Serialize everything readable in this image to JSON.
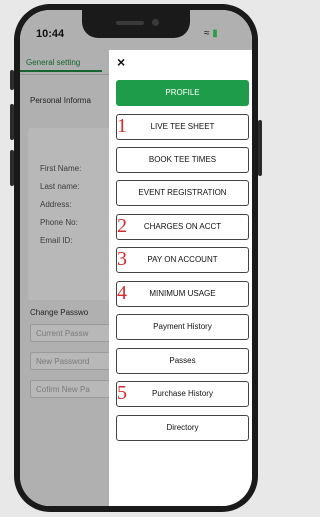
{
  "status": {
    "time": "10:44"
  },
  "background": {
    "tab": "General setting",
    "section_title": "Personal Informa",
    "fields": [
      "First Name:",
      "Last name:",
      "Address:",
      "Phone No:",
      "Email ID:"
    ],
    "change_password_title": "Change Passwo",
    "password_placeholders": [
      "Current Passw",
      "New Password",
      "Cofirm New Pa"
    ]
  },
  "menu": {
    "close": "×",
    "items": [
      {
        "label": "PROFILE",
        "primary": true,
        "number": ""
      },
      {
        "label": "LIVE TEE SHEET",
        "number": "1"
      },
      {
        "label": "BOOK TEE TIMES",
        "number": ""
      },
      {
        "label": "EVENT REGISTRATION",
        "number": ""
      },
      {
        "label": "CHARGES ON ACCT",
        "number": "2"
      },
      {
        "label": "PAY ON ACCOUNT",
        "number": "3"
      },
      {
        "label": "MINIMUM USAGE",
        "number": "4"
      },
      {
        "label": "Payment History",
        "number": ""
      },
      {
        "label": "Passes",
        "number": ""
      },
      {
        "label": "Purchase History",
        "number": "5"
      },
      {
        "label": "Directory",
        "number": ""
      }
    ]
  },
  "colors": {
    "accent": "#1e9c4a",
    "annotation": "#d62b2b"
  }
}
